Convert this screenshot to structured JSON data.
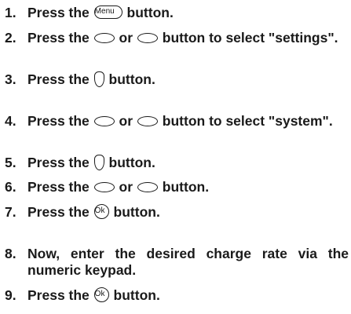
{
  "steps": [
    {
      "num": "1.",
      "t1": "Press the",
      "menu_key": "Menu",
      "t2": "button."
    },
    {
      "num": "2.",
      "t1": "Press the",
      "t2": "or",
      "t3": "button to select \"settings\"."
    },
    {
      "num": "3.",
      "t1": "Press the",
      "t2": "button."
    },
    {
      "num": "4.",
      "t1": "Press the",
      "t2": "or",
      "t3": "button to select \"system\"."
    },
    {
      "num": "5.",
      "t1": "Press the",
      "t2": "button."
    },
    {
      "num": "6.",
      "t1": "Press the",
      "t2": "or",
      "t3": "button."
    },
    {
      "num": "7.",
      "t1": "Press the",
      "ok_key": "Ok",
      "t2": "button."
    },
    {
      "num": "8.",
      "t1": "Now, enter the desired charge rate via the numeric keypad."
    },
    {
      "num": "9.",
      "t1": "Press the",
      "ok_key": "Ok",
      "t2": "button."
    }
  ],
  "icons": {
    "menu": "menu-key-icon",
    "nav": "navigation-key-icon",
    "side": "side-key-icon",
    "ok": "ok-key-icon"
  }
}
